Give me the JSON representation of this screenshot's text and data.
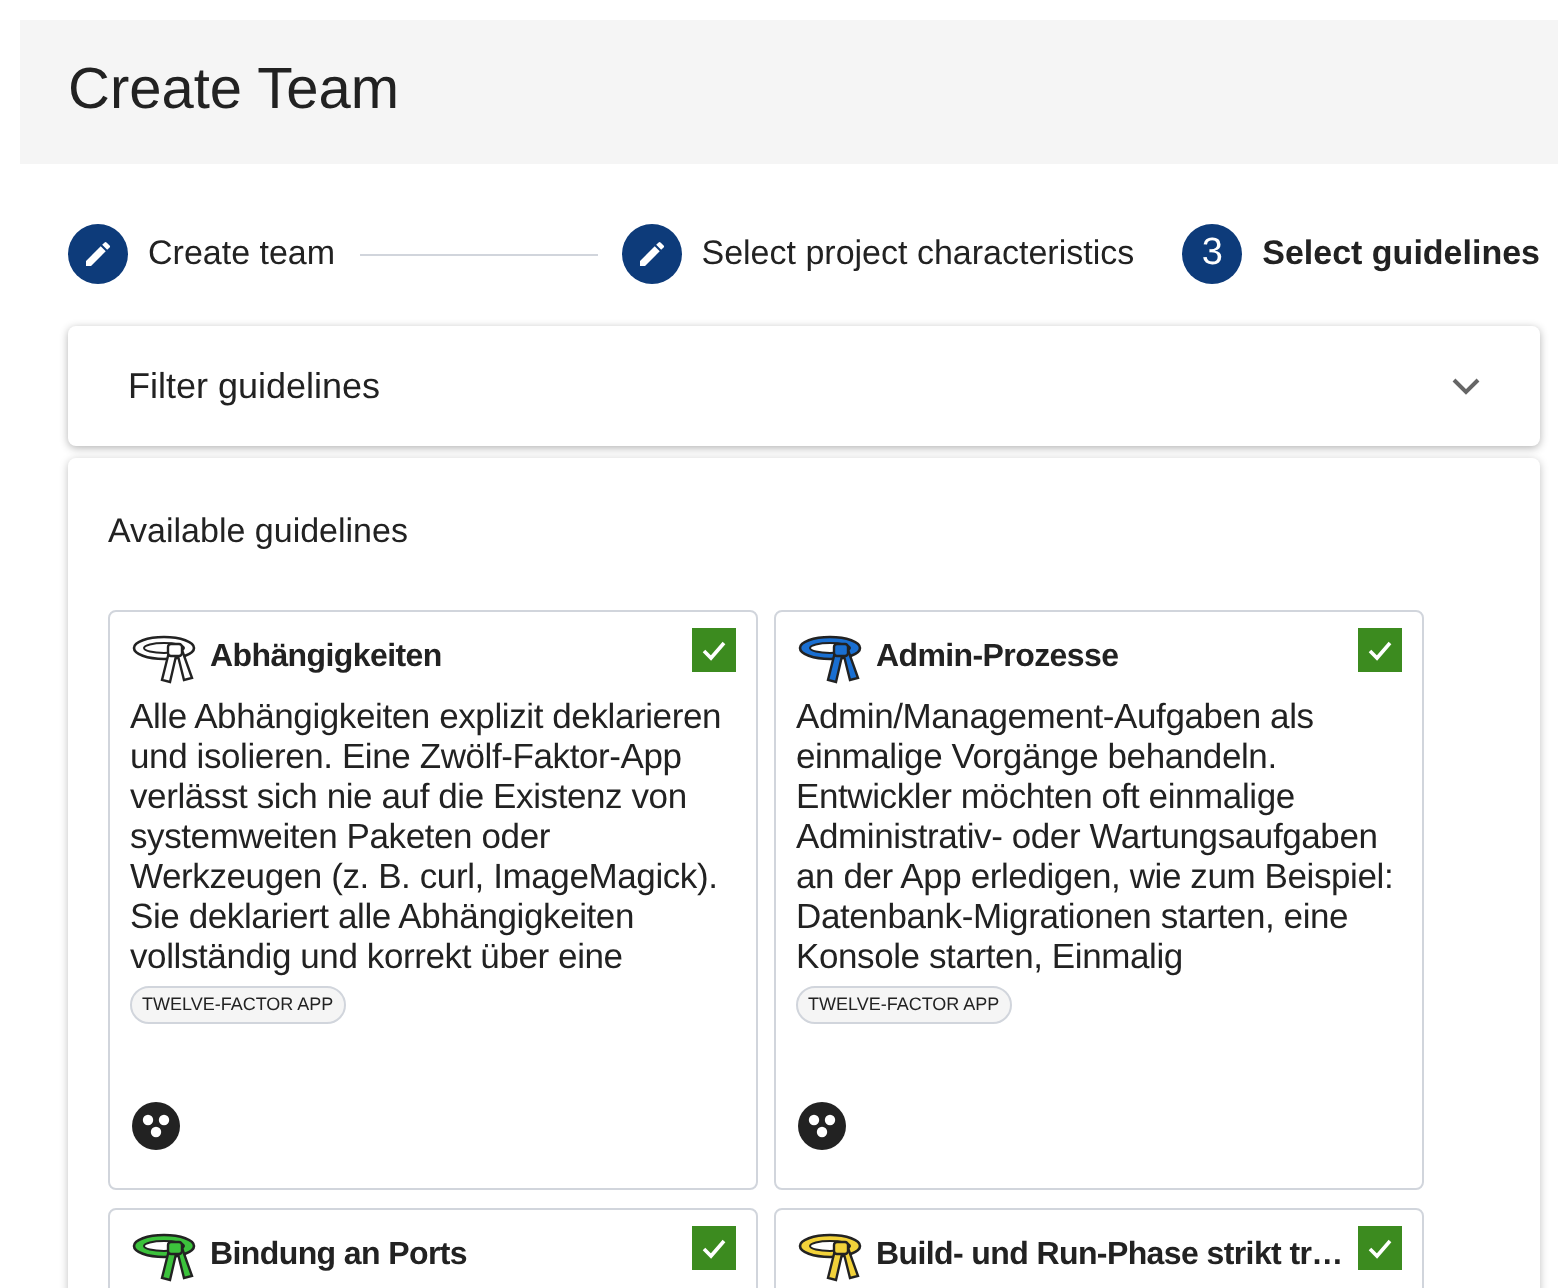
{
  "header": {
    "title": "Create Team"
  },
  "stepper": [
    {
      "label": "Create team",
      "kind": "edit",
      "selected": false
    },
    {
      "label": "Select project characteristics",
      "kind": "edit",
      "selected": false
    },
    {
      "label": "Select guidelines",
      "kind": "number",
      "number": "3",
      "selected": true
    }
  ],
  "filter": {
    "label": "Filter guidelines",
    "expanded": false
  },
  "guidelines": {
    "title": "Available guidelines",
    "cards": [
      {
        "title": "Abhängigkeiten",
        "color": "#ffffff",
        "checked": true,
        "description": "Alle Abhängigkeiten explizit deklarieren und isolieren. Eine Zwölf-Faktor-App verlässt sich nie auf die Existenz von systemweiten Paketen oder Werkzeugen (z. B. curl, ImageMagick). Sie deklariert alle Abhängigkeiten vollständig und korrekt über eine",
        "tag": "TWELVE-FACTOR APP"
      },
      {
        "title": "Admin-Prozesse",
        "color": "#1a6fd1",
        "checked": true,
        "description": "Admin/Management-Aufgaben als einmalige Vorgänge behandeln. Entwickler möchten oft einmalige Administrativ- oder Wartungsaufgaben an der App erledigen, wie zum Beispiel: Datenbank-Migrationen starten, eine Konsole starten, Einmalig",
        "tag": "TWELVE-FACTOR APP"
      },
      {
        "title": "Bindung an Ports",
        "color": "#3cc23c",
        "checked": true
      },
      {
        "title": "Build- und Run-Phase strikt tr…",
        "color": "#f2d23a",
        "checked": true
      }
    ]
  }
}
